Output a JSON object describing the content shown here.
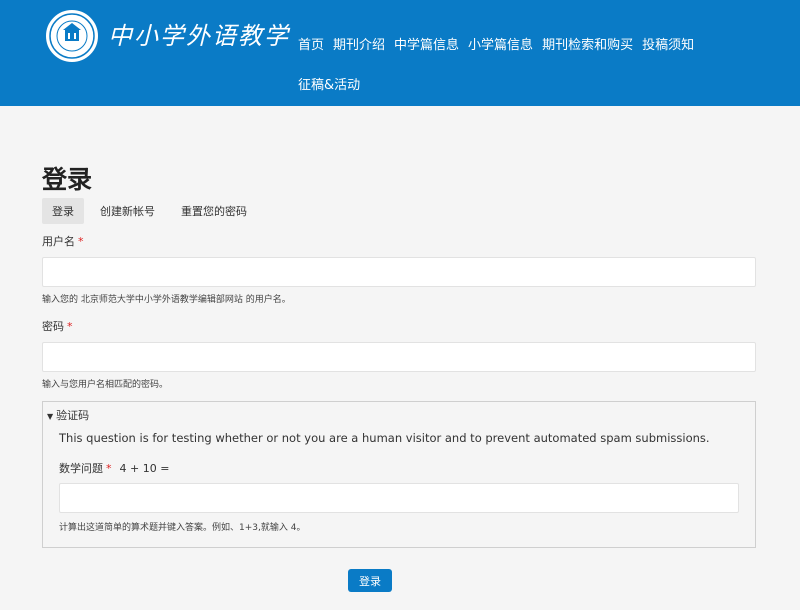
{
  "site": {
    "logo_text": "中小学外语教学",
    "seal_text": "BEIJING NORMAL UNIVERSITY",
    "seal_year": "1902"
  },
  "nav": {
    "items": [
      "首页",
      "期刊介绍",
      "中学篇信息",
      "小学篇信息",
      "期刊检索和购买",
      "投稿须知"
    ],
    "second_row": "征稿&活动"
  },
  "page": {
    "title": "登录",
    "tabs": [
      "登录",
      "创建新帐号",
      "重置您的密码"
    ]
  },
  "form": {
    "username_label": "用户名",
    "username_value": "",
    "username_hint": "输入您的 北京师范大学中小学外语教学编辑部网站 的用户名。",
    "password_label": "密码",
    "password_value": "",
    "password_hint": "输入与您用户名相匹配的密码。",
    "required_mark": "*"
  },
  "captcha": {
    "legend": "验证码",
    "legend_icon": "triangle-down-icon",
    "description": "This question is for testing whether or not you are a human visitor and to prevent automated spam submissions.",
    "math_label": "数学问题",
    "question": "4 + 10 =",
    "value": "",
    "hint": "计算出这道简单的算术题并键入答案。例如、1+3,就输入 4。"
  },
  "submit_label": "登录",
  "colors": {
    "header_bg": "#0a7bc6",
    "button_bg": "#0a7bc6",
    "required": "#dd2222"
  }
}
